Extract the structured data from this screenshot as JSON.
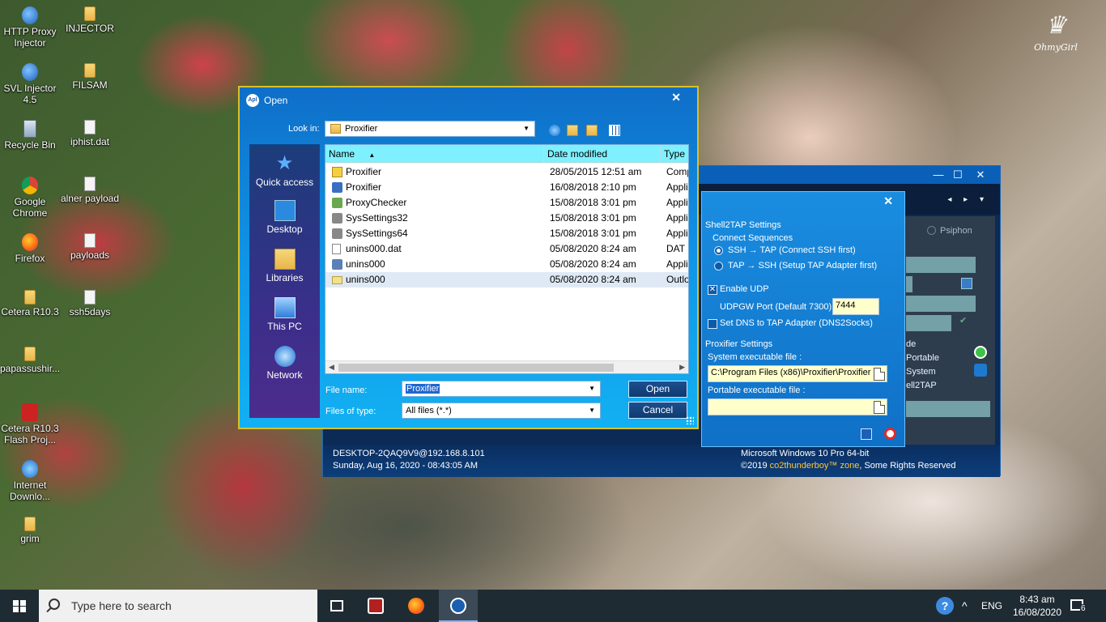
{
  "desktop": {
    "logo_text": "OhmyGirl",
    "icons": [
      {
        "label": "HTTP Proxy Injector"
      },
      {
        "label": "INJECTOR"
      },
      {
        "label": "SVL Injector 4.5"
      },
      {
        "label": "FILSAM"
      },
      {
        "label": "Recycle Bin"
      },
      {
        "label": "iphist.dat"
      },
      {
        "label": "Google Chrome"
      },
      {
        "label": "alner payload"
      },
      {
        "label": "Firefox"
      },
      {
        "label": "payloads"
      },
      {
        "label": "Cetera R10.3"
      },
      {
        "label": "ssh5days"
      },
      {
        "label": "papassushir..."
      },
      {
        "label": "Cetera R10.3 Flash Proj..."
      },
      {
        "label": "Internet Downlo..."
      },
      {
        "label": "grim"
      }
    ]
  },
  "bg_app": {
    "minimize": "—",
    "maximize": "☐",
    "close": "✕",
    "nav_arrows": "◂ ▸ ▾",
    "psiphon_label": "Psiphon",
    "right_labels": [
      "de",
      "Portable",
      "System",
      "ell2TAP"
    ],
    "status": {
      "host": "DESKTOP-2QAQ9V9@192.168.8.101",
      "datetime": "Sunday, Aug 16, 2020 - 08:43:05 AM",
      "os": "Microsoft Windows 10 Pro 64-bit",
      "copyright_prefix": "©2019",
      "brand": "co2thunderboy™ zone",
      "copyright_suffix": ", Some Rights Reserved"
    }
  },
  "shell2tap": {
    "close": "✕",
    "section1": "Shell2TAP Settings",
    "connect_seq": "Connect Sequences",
    "opt1": "SSH → TAP (Connect SSH first)",
    "opt2": "TAP → SSH (Setup TAP Adapter first)",
    "enable_udp": "Enable UDP",
    "udpgw_label": "UDPGW Port (Default 7300)",
    "udpgw_value": "7444",
    "set_dns": "Set DNS to TAP Adapter (DNS2Socks)",
    "section2": "Proxifier Settings",
    "sys_exe_label": "System executable file :",
    "sys_exe_value": "C:\\Program Files (x86)\\Proxifier\\Proxifier",
    "port_exe_label": "Portable executable file :",
    "port_exe_value": ""
  },
  "open_dialog": {
    "title": "Open",
    "app_icon_text": "Apl",
    "close": "✕",
    "look_in_label": "Look in:",
    "look_in_value": "Proxifier",
    "places": [
      "Quick access",
      "Desktop",
      "Libraries",
      "This PC",
      "Network"
    ],
    "columns": {
      "name": "Name",
      "date": "Date modified",
      "type": "Type"
    },
    "files": [
      {
        "name": "Proxifier",
        "date": "28/05/2015 12:51 am",
        "type": "Comp"
      },
      {
        "name": "Proxifier",
        "date": "16/08/2018 2:10 pm",
        "type": "Appli"
      },
      {
        "name": "ProxyChecker",
        "date": "15/08/2018 3:01 pm",
        "type": "Appli"
      },
      {
        "name": "SysSettings32",
        "date": "15/08/2018 3:01 pm",
        "type": "Appli"
      },
      {
        "name": "SysSettings64",
        "date": "15/08/2018 3:01 pm",
        "type": "Appli"
      },
      {
        "name": "unins000.dat",
        "date": "05/08/2020 8:24 am",
        "type": "DAT F"
      },
      {
        "name": "unins000",
        "date": "05/08/2020 8:24 am",
        "type": "Appli"
      },
      {
        "name": "unins000",
        "date": "05/08/2020 8:24 am",
        "type": "Outlo"
      }
    ],
    "file_name_label": "File name:",
    "file_name_value": "Proxifier",
    "file_type_label": "Files of type:",
    "file_type_value": "All files (*.*)",
    "open_button": "Open",
    "cancel_button": "Cancel"
  },
  "taskbar": {
    "search_placeholder": "Type here to search",
    "language": "ENG",
    "time": "8:43 am",
    "date": "16/08/2020",
    "notification_count": "6",
    "tray_chevron": "^",
    "help": "?"
  }
}
